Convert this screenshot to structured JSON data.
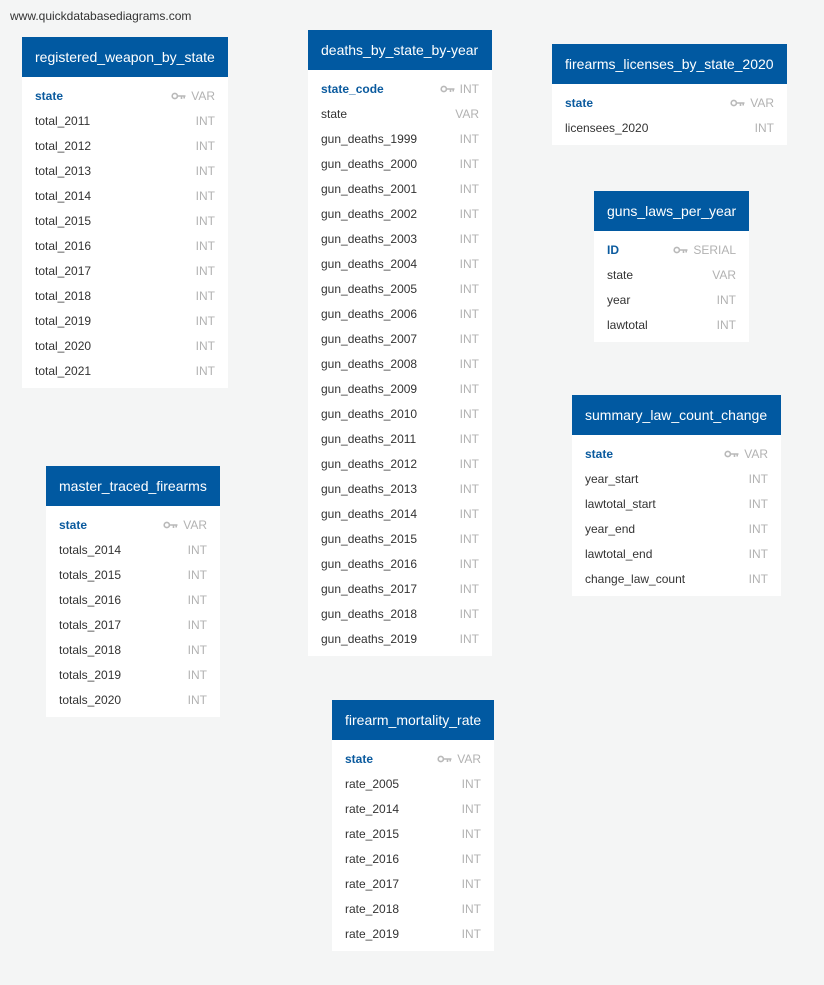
{
  "watermark": "www.quickdatabasediagrams.com",
  "tables": [
    {
      "id": "registered_weapon_by_state",
      "name": "registered_weapon_by_state",
      "fields": [
        {
          "name": "state",
          "type": "VAR",
          "pk": true
        },
        {
          "name": "total_2011",
          "type": "INT"
        },
        {
          "name": "total_2012",
          "type": "INT"
        },
        {
          "name": "total_2013",
          "type": "INT"
        },
        {
          "name": "total_2014",
          "type": "INT"
        },
        {
          "name": "total_2015",
          "type": "INT"
        },
        {
          "name": "total_2016",
          "type": "INT"
        },
        {
          "name": "total_2017",
          "type": "INT"
        },
        {
          "name": "total_2018",
          "type": "INT"
        },
        {
          "name": "total_2019",
          "type": "INT"
        },
        {
          "name": "total_2020",
          "type": "INT"
        },
        {
          "name": "total_2021",
          "type": "INT"
        }
      ]
    },
    {
      "id": "deaths_by_state_by_year",
      "name": "deaths_by_state_by-year",
      "fields": [
        {
          "name": "state_code",
          "type": "INT",
          "pk": true
        },
        {
          "name": "state",
          "type": "VAR"
        },
        {
          "name": "gun_deaths_1999",
          "type": "INT"
        },
        {
          "name": "gun_deaths_2000",
          "type": "INT"
        },
        {
          "name": "gun_deaths_2001",
          "type": "INT"
        },
        {
          "name": "gun_deaths_2002",
          "type": "INT"
        },
        {
          "name": "gun_deaths_2003",
          "type": "INT"
        },
        {
          "name": "gun_deaths_2004",
          "type": "INT"
        },
        {
          "name": "gun_deaths_2005",
          "type": "INT"
        },
        {
          "name": "gun_deaths_2006",
          "type": "INT"
        },
        {
          "name": "gun_deaths_2007",
          "type": "INT"
        },
        {
          "name": "gun_deaths_2008",
          "type": "INT"
        },
        {
          "name": "gun_deaths_2009",
          "type": "INT"
        },
        {
          "name": "gun_deaths_2010",
          "type": "INT"
        },
        {
          "name": "gun_deaths_2011",
          "type": "INT"
        },
        {
          "name": "gun_deaths_2012",
          "type": "INT"
        },
        {
          "name": "gun_deaths_2013",
          "type": "INT"
        },
        {
          "name": "gun_deaths_2014",
          "type": "INT"
        },
        {
          "name": "gun_deaths_2015",
          "type": "INT"
        },
        {
          "name": "gun_deaths_2016",
          "type": "INT"
        },
        {
          "name": "gun_deaths_2017",
          "type": "INT"
        },
        {
          "name": "gun_deaths_2018",
          "type": "INT"
        },
        {
          "name": "gun_deaths_2019",
          "type": "INT"
        }
      ]
    },
    {
      "id": "firearms_licenses_by_state_2020",
      "name": "firearms_licenses_by_state_2020",
      "fields": [
        {
          "name": "state",
          "type": "VAR",
          "pk": true
        },
        {
          "name": "licensees_2020",
          "type": "INT"
        }
      ]
    },
    {
      "id": "guns_laws_per_year",
      "name": "guns_laws_per_year",
      "fields": [
        {
          "name": "ID",
          "type": "SERIAL",
          "pk": true
        },
        {
          "name": "state",
          "type": "VAR"
        },
        {
          "name": "year",
          "type": "INT"
        },
        {
          "name": "lawtotal",
          "type": "INT"
        }
      ]
    },
    {
      "id": "summary_law_count_change",
      "name": "summary_law_count_change",
      "fields": [
        {
          "name": "state",
          "type": "VAR",
          "pk": true
        },
        {
          "name": "year_start",
          "type": "INT"
        },
        {
          "name": "lawtotal_start",
          "type": "INT"
        },
        {
          "name": "year_end",
          "type": "INT"
        },
        {
          "name": "lawtotal_end",
          "type": "INT"
        },
        {
          "name": "change_law_count",
          "type": "INT"
        }
      ]
    },
    {
      "id": "master_traced_firearms",
      "name": "master_traced_firearms",
      "fields": [
        {
          "name": "state",
          "type": "VAR",
          "pk": true
        },
        {
          "name": "totals_2014",
          "type": "INT"
        },
        {
          "name": "totals_2015",
          "type": "INT"
        },
        {
          "name": "totals_2016",
          "type": "INT"
        },
        {
          "name": "totals_2017",
          "type": "INT"
        },
        {
          "name": "totals_2018",
          "type": "INT"
        },
        {
          "name": "totals_2019",
          "type": "INT"
        },
        {
          "name": "totals_2020",
          "type": "INT"
        }
      ]
    },
    {
      "id": "firearm_mortality_rate",
      "name": "firearm_mortality_rate",
      "fields": [
        {
          "name": "state",
          "type": "VAR",
          "pk": true
        },
        {
          "name": "rate_2005",
          "type": "INT"
        },
        {
          "name": "rate_2014",
          "type": "INT"
        },
        {
          "name": "rate_2015",
          "type": "INT"
        },
        {
          "name": "rate_2016",
          "type": "INT"
        },
        {
          "name": "rate_2017",
          "type": "INT"
        },
        {
          "name": "rate_2018",
          "type": "INT"
        },
        {
          "name": "rate_2019",
          "type": "INT"
        }
      ]
    }
  ],
  "colors": {
    "header": "#0159a1",
    "pk_text": "#0a5a9e",
    "type_text": "#b2b2b2",
    "background": "#f4f5f5"
  },
  "icons": {
    "primary_key": "key-icon"
  }
}
